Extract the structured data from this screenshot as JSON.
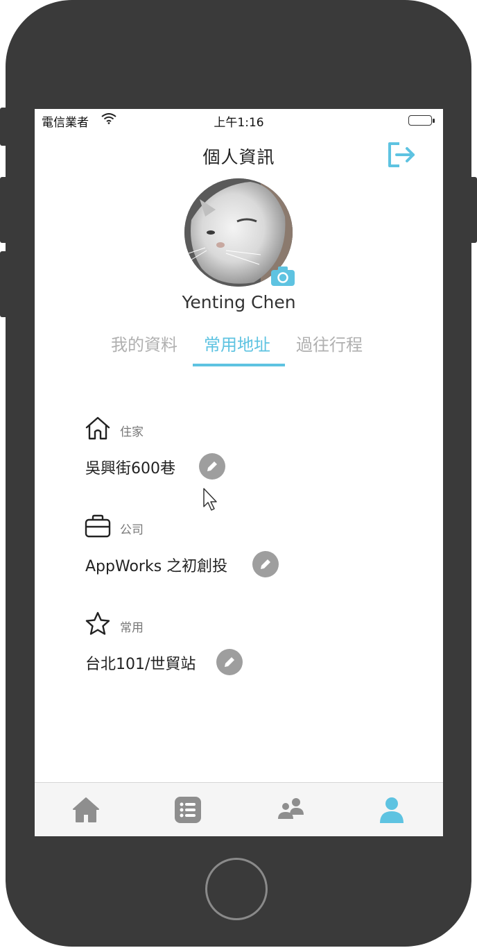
{
  "status_bar": {
    "carrier": "電信業者",
    "time": "上午1:16"
  },
  "header": {
    "title": "個人資訊",
    "logout_icon": "logout-icon"
  },
  "profile": {
    "name": "Yenting Chen",
    "avatar": "cat-photo",
    "camera_icon": "camera-icon"
  },
  "tabs": [
    {
      "label": "我的資料",
      "active": false
    },
    {
      "label": "常用地址",
      "active": true
    },
    {
      "label": "過往行程",
      "active": false
    }
  ],
  "addresses": [
    {
      "icon": "home-outline-icon",
      "label": "住家",
      "value": "吳興街600巷"
    },
    {
      "icon": "briefcase-icon",
      "label": "公司",
      "value": "AppWorks 之初創投"
    },
    {
      "icon": "star-outline-icon",
      "label": "常用",
      "value": "台北101/世貿站"
    }
  ],
  "tab_bar": {
    "items": [
      {
        "icon": "home-icon",
        "active": false
      },
      {
        "icon": "list-icon",
        "active": false
      },
      {
        "icon": "group-icon",
        "active": false
      },
      {
        "icon": "profile-icon",
        "active": true
      }
    ]
  },
  "colors": {
    "accent": "#5ec3e1",
    "inactive": "#9e9e9e",
    "frame": "#3a3a3a"
  }
}
